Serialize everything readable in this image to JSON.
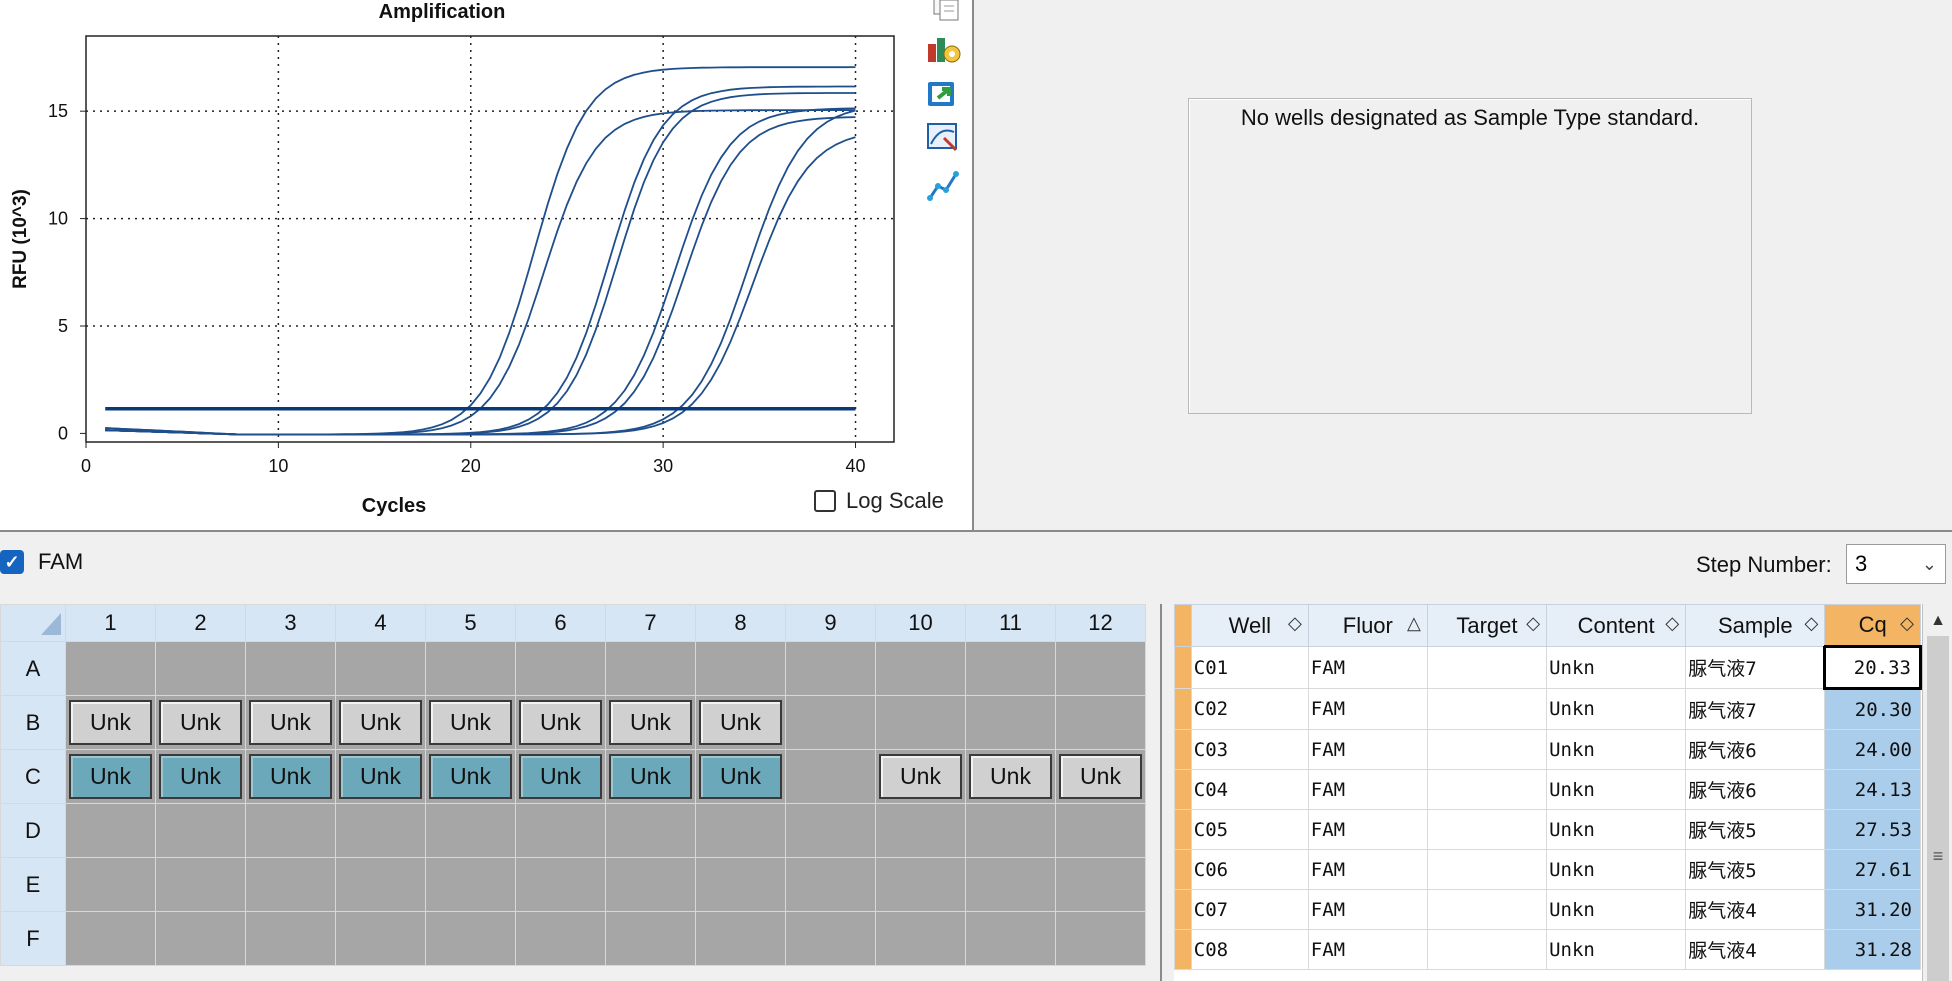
{
  "chart_data": {
    "type": "line",
    "title": "Amplification",
    "xlabel": "Cycles",
    "ylabel": "RFU (10^3)",
    "xlim": [
      0,
      42
    ],
    "ylim": [
      -0.4,
      18.5
    ],
    "x_ticks": [
      "0",
      "10",
      "20",
      "30",
      "40"
    ],
    "y_ticks": [
      "0",
      "5",
      "10",
      "15"
    ],
    "grid": true,
    "threshold": 1.15,
    "curves": [
      {
        "baseline": 0.3,
        "plateau": 17.1,
        "midpoint": 23.3,
        "slope": 1.35
      },
      {
        "baseline": 0.3,
        "plateau": 15.1,
        "midpoint": 23.8,
        "slope": 1.35
      },
      {
        "baseline": 0.2,
        "plateau": 16.2,
        "midpoint": 27.2,
        "slope": 1.35
      },
      {
        "baseline": 0.2,
        "plateau": 15.9,
        "midpoint": 27.6,
        "slope": 1.35
      },
      {
        "baseline": 0.2,
        "plateau": 15.2,
        "midpoint": 30.6,
        "slope": 1.4
      },
      {
        "baseline": 0.2,
        "plateau": 14.8,
        "midpoint": 31.1,
        "slope": 1.4
      },
      {
        "baseline": 0.2,
        "plateau": 15.4,
        "midpoint": 34.4,
        "slope": 1.45
      },
      {
        "baseline": 0.2,
        "plateau": 14.2,
        "midpoint": 34.7,
        "slope": 1.45
      }
    ],
    "x_range_data": [
      1,
      40
    ]
  },
  "toolbar": {
    "icons": [
      "copy-icon",
      "chart-settings-icon",
      "export-icon",
      "zoom-chart-icon",
      "curve-fit-icon"
    ]
  },
  "log_scale_label": "Log Scale",
  "standard_message": "No wells designated as Sample Type standard.",
  "fluor_checkbox_label": "FAM",
  "step_number": {
    "label": "Step Number:",
    "value": "3"
  },
  "plate": {
    "columns": [
      "1",
      "2",
      "3",
      "4",
      "5",
      "6",
      "7",
      "8",
      "9",
      "10",
      "11",
      "12"
    ],
    "rows": [
      "A",
      "B",
      "C",
      "D",
      "E",
      "F"
    ],
    "well_label": "Unk"
  },
  "results": {
    "columns": [
      "Well",
      "Fluor",
      "Target",
      "Content",
      "Sample",
      "Cq"
    ],
    "rows": [
      {
        "well": "C01",
        "fluor": "FAM",
        "target": "",
        "content": "Unkn",
        "sample": "脲气液7",
        "cq": "20.33"
      },
      {
        "well": "C02",
        "fluor": "FAM",
        "target": "",
        "content": "Unkn",
        "sample": "脲气液7",
        "cq": "20.30"
      },
      {
        "well": "C03",
        "fluor": "FAM",
        "target": "",
        "content": "Unkn",
        "sample": "脲气液6",
        "cq": "24.00"
      },
      {
        "well": "C04",
        "fluor": "FAM",
        "target": "",
        "content": "Unkn",
        "sample": "脲气液6",
        "cq": "24.13"
      },
      {
        "well": "C05",
        "fluor": "FAM",
        "target": "",
        "content": "Unkn",
        "sample": "脲气液5",
        "cq": "27.53"
      },
      {
        "well": "C06",
        "fluor": "FAM",
        "target": "",
        "content": "Unkn",
        "sample": "脲气液5",
        "cq": "27.61"
      },
      {
        "well": "C07",
        "fluor": "FAM",
        "target": "",
        "content": "Unkn",
        "sample": "脲气液4",
        "cq": "31.20"
      },
      {
        "well": "C08",
        "fluor": "FAM",
        "target": "",
        "content": "Unkn",
        "sample": "脲气液4",
        "cq": "31.28"
      }
    ]
  },
  "colors": {
    "curve": "#1f4e8c",
    "threshold": "#0a3a7a",
    "selected_well": "#6aa8ba"
  }
}
